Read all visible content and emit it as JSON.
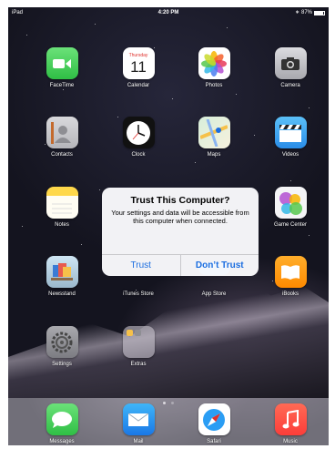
{
  "status_bar": {
    "device": "iPad",
    "time": "4:20 PM",
    "battery": "87%"
  },
  "apps": {
    "facetime": "FaceTime",
    "calendar": "Calendar",
    "calendar_day_name": "Thursday",
    "calendar_day_number": "11",
    "photos": "Photos",
    "camera": "Camera",
    "contacts": "Contacts",
    "clock": "Clock",
    "maps": "Maps",
    "videos": "Videos",
    "notes": "Notes",
    "game_center": "Game Center",
    "newsstand": "Newsstand",
    "itunes_store": "iTunes Store",
    "app_store": "App Store",
    "ibooks": "iBooks",
    "settings": "Settings",
    "extras": "Extras"
  },
  "dock": {
    "messages": "Messages",
    "mail": "Mail",
    "safari": "Safari",
    "music": "Music"
  },
  "alert": {
    "title": "Trust This Computer?",
    "message": "Your settings and data will be accessible from this computer when connected.",
    "trust_label": "Trust",
    "dont_trust_label": "Don’t Trust"
  },
  "page_indicator": {
    "pages": 2,
    "current": 1
  },
  "colors": {
    "alert_button": "#1a6de0",
    "facetime": "#4cd964",
    "messages": "#4cd964",
    "music": "#fc3d39",
    "ibooks": "#ff9500"
  }
}
